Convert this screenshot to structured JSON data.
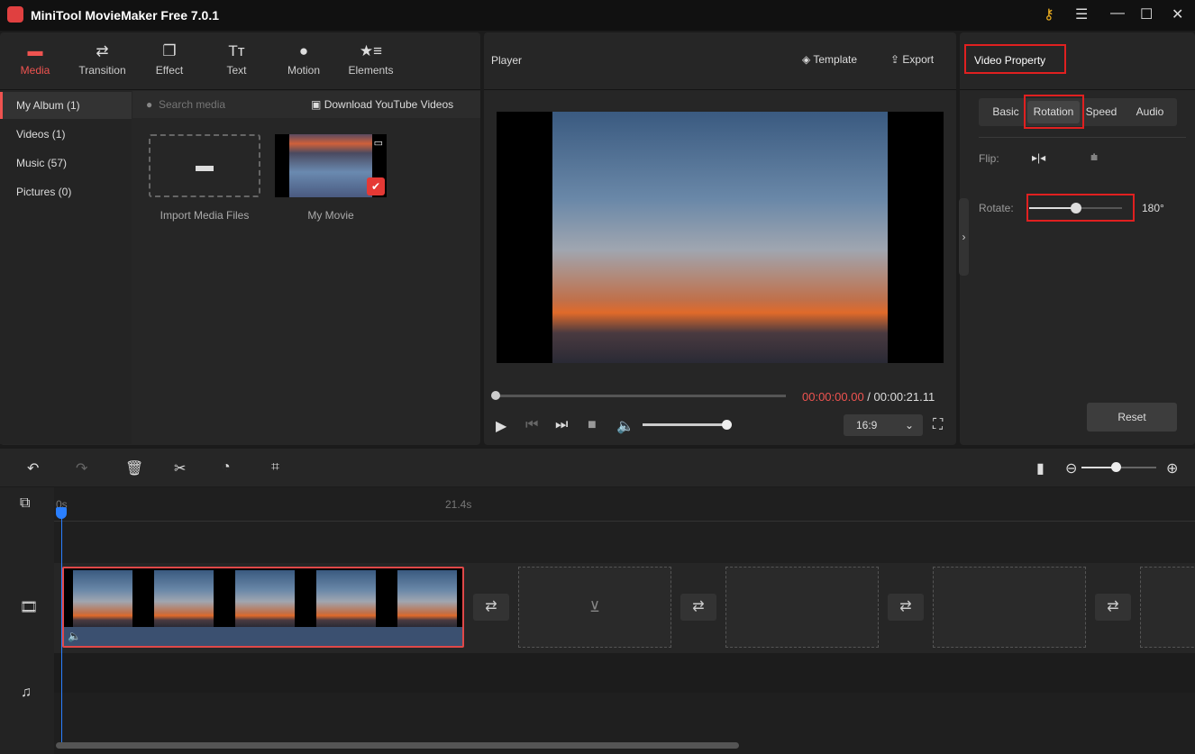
{
  "app": {
    "title": "MiniTool MovieMaker Free 7.0.1"
  },
  "toolbar": [
    {
      "label": "Media",
      "icon": "folder-icon",
      "active": true
    },
    {
      "label": "Transition",
      "icon": "swap-icon"
    },
    {
      "label": "Effect",
      "icon": "effect-icon"
    },
    {
      "label": "Text",
      "icon": "text-icon"
    },
    {
      "label": "Motion",
      "icon": "motion-icon"
    },
    {
      "label": "Elements",
      "icon": "elements-icon"
    }
  ],
  "sidebar": [
    {
      "label": "My Album (1)",
      "active": true
    },
    {
      "label": "Videos (1)"
    },
    {
      "label": "Music (57)"
    },
    {
      "label": "Pictures (0)"
    }
  ],
  "media": {
    "search_placeholder": "Search media",
    "download": "Download YouTube Videos",
    "import_label": "Import Media Files",
    "clip_label": "My Movie"
  },
  "player": {
    "title": "Player",
    "template": "Template",
    "export": "Export",
    "current_time": "00:00:00.00",
    "separator": " / ",
    "total_time": "00:00:21.11",
    "aspect": "16:9",
    "volume_percent": 100,
    "progress_percent": 0
  },
  "property": {
    "title": "Video Property",
    "tabs": [
      "Basic",
      "Rotation",
      "Speed",
      "Audio"
    ],
    "active_tab": "Rotation",
    "flip_label": "Flip:",
    "rotate_label": "Rotate:",
    "rotate_value": "180°",
    "rotate_degrees": 180,
    "reset": "Reset"
  },
  "timeline": {
    "ruler": [
      "0s",
      "21.4s"
    ],
    "zoom_percent": 65
  },
  "colors": {
    "accent": "#ef5350",
    "highlight": "#e02020",
    "playhead": "#2a7fff"
  }
}
